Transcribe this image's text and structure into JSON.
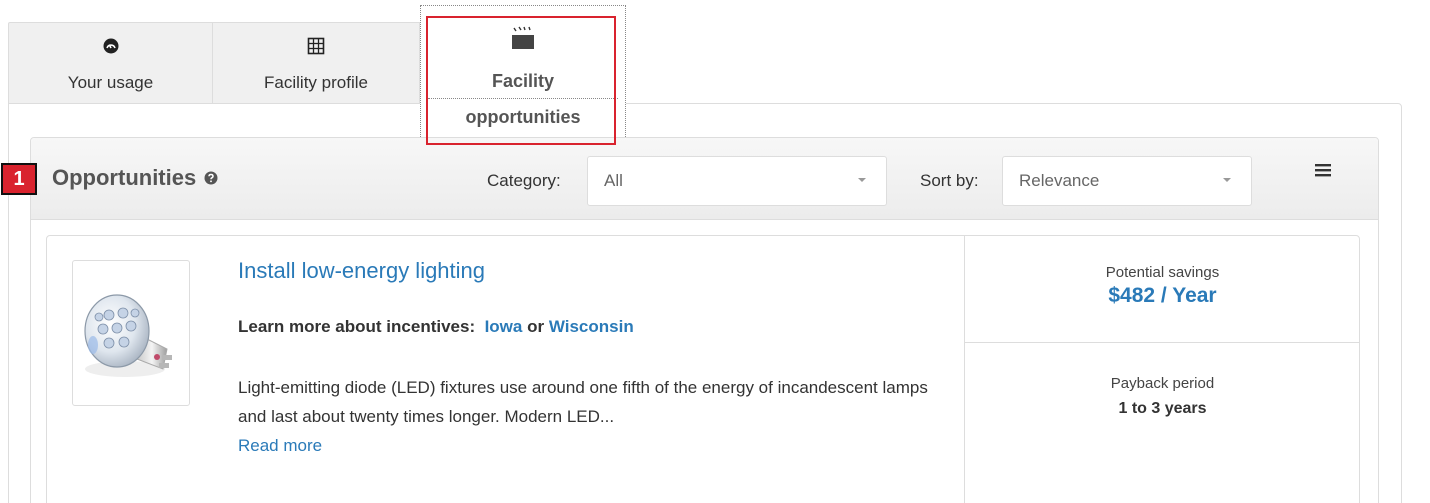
{
  "tabs": {
    "usage": {
      "label": "Your usage",
      "icon": "gauge-icon"
    },
    "profile": {
      "label": "Facility profile",
      "icon": "building-grid-icon"
    },
    "opportunities": {
      "label_line1": "Facility",
      "label_line2": "opportunities",
      "icon": "clapperboard-icon"
    }
  },
  "annotation": {
    "number": "1",
    "color": "#d9232e"
  },
  "opportunities": {
    "title": "Opportunities",
    "category_label": "Category:",
    "category_value": "All",
    "sort_label": "Sort by:",
    "sort_value": "Relevance"
  },
  "card": {
    "title": "Install low-energy lighting",
    "incentives_prefix": "Learn more about incentives:",
    "incentive_link_1": "Iowa",
    "incentives_or": "or",
    "incentive_link_2": "Wisconsin",
    "description": "Light-emitting diode (LED) fixtures use around one fifth of the energy of incandescent lamps and last about twenty times longer. Modern LED...",
    "read_more": "Read more",
    "savings_label": "Potential savings",
    "savings_value": "$482 / Year",
    "payback_label": "Payback period",
    "payback_value": "1 to 3 years"
  },
  "colors": {
    "link": "#2a7ab8",
    "accent_red": "#d9232e"
  }
}
